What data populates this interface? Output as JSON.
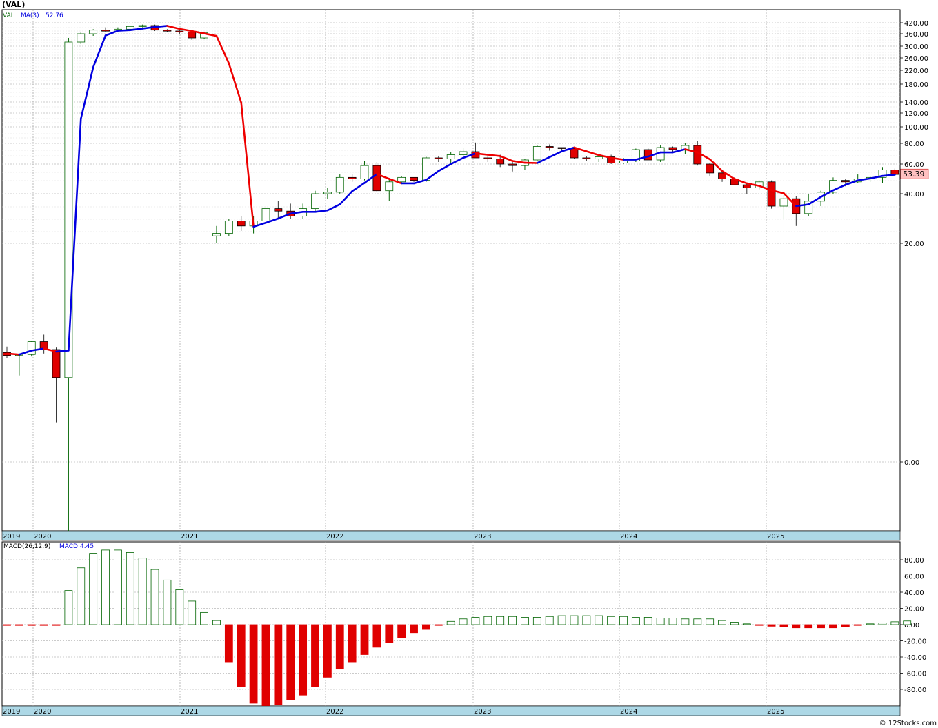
{
  "title": "(VAL)",
  "credit": "© 12Stocks.com",
  "colors": {
    "up": "#006400",
    "down": "#e00000",
    "ma_up": "#0000e0",
    "ma_down": "#ee0000",
    "axis_band": "#add8e6"
  },
  "price_panel": {
    "legend_symbol": "VAL",
    "legend_ma": "MA(3)",
    "legend_ma_value": "52.76",
    "last_price": "53.39"
  },
  "macd_panel": {
    "legend_label": "MACD(26,12,9)",
    "legend_value": "MACD:4.45"
  },
  "chart_data": [
    {
      "type": "candlestick",
      "scale": "log",
      "title": "",
      "y_tick_labels": [
        "420.00",
        "360.00",
        "300.00",
        "260.00",
        "220.00",
        "180.00",
        "140.00",
        "120.00",
        "100.00",
        "80.00",
        "60.00",
        "40.00",
        "20.00",
        "0.00"
      ],
      "x_tick_labels": [
        "2019",
        "2020",
        "2021",
        "2022",
        "2023",
        "2024",
        "2025"
      ],
      "candles": [
        [
          9.0,
          9.6,
          8.4,
          8.7
        ],
        [
          8.7,
          8.9,
          7.6,
          8.8
        ],
        [
          8.8,
          10.2,
          8.6,
          10.1
        ],
        [
          10.1,
          10.8,
          8.9,
          9.3
        ],
        [
          9.3,
          9.5,
          5.4,
          7.5
        ],
        [
          7.5,
          340,
          0.3,
          320
        ],
        [
          320,
          370,
          310,
          360
        ],
        [
          360,
          385,
          350,
          380
        ],
        [
          380,
          395,
          370,
          375
        ],
        [
          375,
          395,
          370,
          385
        ],
        [
          385,
          405,
          380,
          400
        ],
        [
          400,
          410,
          395,
          405
        ],
        [
          405,
          410,
          375,
          380
        ],
        [
          380,
          385,
          370,
          375
        ],
        [
          375,
          380,
          360,
          370
        ],
        [
          370,
          375,
          330,
          340
        ],
        [
          340,
          370,
          335,
          365
        ],
        [
          23,
          27,
          20,
          24
        ],
        [
          24,
          30,
          23,
          29
        ],
        [
          29,
          31,
          25,
          27
        ],
        [
          27,
          31,
          24,
          29
        ],
        [
          29,
          35,
          28,
          34
        ],
        [
          34,
          37,
          30,
          33
        ],
        [
          33,
          36,
          30,
          31
        ],
        [
          31,
          36,
          30,
          34
        ],
        [
          34,
          42,
          33,
          40
        ],
        [
          40,
          44,
          38,
          41
        ],
        [
          41,
          53,
          40,
          51
        ],
        [
          51,
          53,
          48,
          50
        ],
        [
          50,
          63,
          49,
          59
        ],
        [
          59,
          62,
          41,
          42
        ],
        [
          42,
          50,
          37,
          48
        ],
        [
          48,
          52,
          47,
          51
        ],
        [
          51,
          51,
          48,
          49
        ],
        [
          49,
          67,
          48,
          66
        ],
        [
          66,
          68,
          62,
          65
        ],
        [
          65,
          72,
          61,
          69
        ],
        [
          69,
          76,
          65,
          72
        ],
        [
          72,
          81,
          66,
          66
        ],
        [
          66,
          70,
          62,
          65
        ],
        [
          65,
          69,
          58,
          60
        ],
        [
          60,
          62,
          55,
          59
        ],
        [
          59,
          65,
          56,
          64
        ],
        [
          64,
          78,
          63,
          77
        ],
        [
          77,
          79,
          73,
          76
        ],
        [
          76,
          76,
          72,
          75
        ],
        [
          75,
          76,
          65,
          66
        ],
        [
          66,
          68,
          63,
          65
        ],
        [
          65,
          70,
          62,
          67
        ],
        [
          67,
          69,
          60,
          61
        ],
        [
          61,
          66,
          60,
          63
        ],
        [
          63,
          75,
          62,
          74
        ],
        [
          74,
          75,
          64,
          64
        ],
        [
          64,
          78,
          62,
          76
        ],
        [
          76,
          77,
          72,
          74
        ],
        [
          74,
          80,
          70,
          78
        ],
        [
          78,
          83,
          59,
          60
        ],
        [
          60,
          61,
          52,
          54
        ],
        [
          54,
          55,
          48,
          50
        ],
        [
          50,
          51,
          46,
          46
        ],
        [
          46,
          47,
          40,
          44
        ],
        [
          44,
          49,
          43,
          48
        ],
        [
          48,
          49,
          34,
          35
        ],
        [
          35,
          40,
          30,
          38
        ],
        [
          38,
          39,
          27,
          32
        ],
        [
          32,
          40,
          31,
          37
        ],
        [
          37,
          42,
          35,
          41
        ],
        [
          41,
          51,
          40,
          49
        ],
        [
          49,
          50,
          45,
          48
        ],
        [
          48,
          53,
          47,
          50
        ],
        [
          50,
          52,
          48,
          51
        ],
        [
          51,
          58,
          47,
          56
        ],
        [
          56,
          57,
          52,
          53
        ]
      ],
      "ma3": [
        8.9,
        8.8,
        9.2,
        9.4,
        9.1,
        9.2,
        111.8,
        229.8,
        351.7,
        376.7,
        380.0,
        388.3,
        396.7,
        403.3,
        386.7,
        375.0,
        361.7,
        349.3,
        242.4,
        139.0,
        26.7,
        28.3,
        30.0,
        32.0,
        32.7,
        32.7,
        33.3,
        35.7,
        41.7,
        47.3,
        53.3,
        50.0,
        47.0,
        47.0,
        49.3,
        55.3,
        60.0,
        66.0,
        70.3,
        69.0,
        67.7,
        63.0,
        61.3,
        61.0,
        66.7,
        72.3,
        76.0,
        72.3,
        68.7,
        66.0,
        64.3,
        64.3,
        67.3,
        71.3,
        71.3,
        74.3,
        71.3,
        64.7,
        55.3,
        50.0,
        47.0,
        45.3,
        42.3,
        40.3,
        35.0,
        35.7,
        38.7,
        42.3,
        46.0,
        49.0,
        50.3,
        52.0,
        52.8
      ]
    },
    {
      "type": "bar",
      "title": "",
      "series_name": "MACD(26,12,9)",
      "y_tick_labels": [
        "80.00",
        "60.00",
        "40.00",
        "20.00",
        "0.00",
        "-20.00",
        "-40.00",
        "-60.00",
        "-80.00"
      ],
      "x_tick_labels": [
        "2019",
        "2020",
        "2021",
        "2022",
        "2023",
        "2024",
        "2025"
      ],
      "ylim": [
        -100,
        92
      ],
      "values": [
        -1.0,
        -1.0,
        -0.5,
        -0.5,
        -0.5,
        42,
        70,
        88,
        92,
        92,
        89,
        82,
        68,
        55,
        43,
        29,
        15,
        5,
        -46,
        -77,
        -97,
        -100,
        -99,
        -93,
        -87,
        -77,
        -65,
        -55,
        -46,
        -37,
        -28,
        -22,
        -16,
        -10,
        -6,
        -1,
        4,
        7,
        9,
        10,
        10,
        10,
        9,
        9,
        10,
        11,
        11,
        11,
        11,
        10,
        10,
        9,
        9,
        8,
        8,
        7,
        7,
        7,
        5,
        3,
        1,
        -1,
        -2,
        -3,
        -4,
        -4,
        -4,
        -4,
        -3,
        -1,
        1,
        2,
        3.5,
        4.45
      ]
    }
  ]
}
